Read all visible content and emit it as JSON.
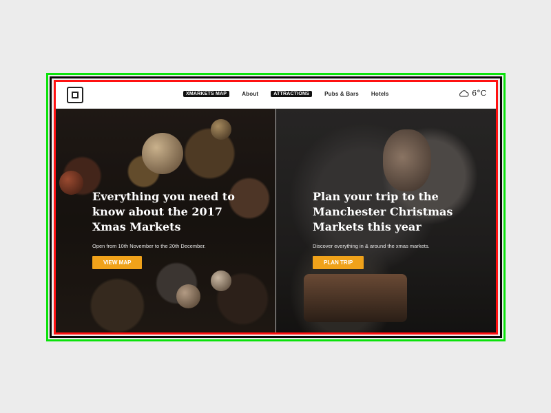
{
  "header": {
    "nav": [
      {
        "label": "ХМАRKETS MAP"
      },
      {
        "label": "About"
      },
      {
        "label": "ATTRACTIONS"
      },
      {
        "label": "Pubs & Bars"
      },
      {
        "label": "Hotels"
      }
    ],
    "weather": {
      "icon": "cloud-icon",
      "temperature": "6°C"
    }
  },
  "hero_left": {
    "headline": "Everything you need to know about the 2017 Xmas Markets",
    "subtitle": "Open from 10th November to the 20th December.",
    "button_label": "VIEW MAP"
  },
  "hero_right": {
    "headline": "Plan your trip to the Manchester Christmas Markets this year",
    "subtitle": "Discover everything in & around the xmas markets.",
    "button_label": "PLAN TRIP"
  },
  "colors": {
    "accent": "#f0a21a",
    "frame_green": "#0be20b",
    "frame_red": "#ff1111"
  }
}
